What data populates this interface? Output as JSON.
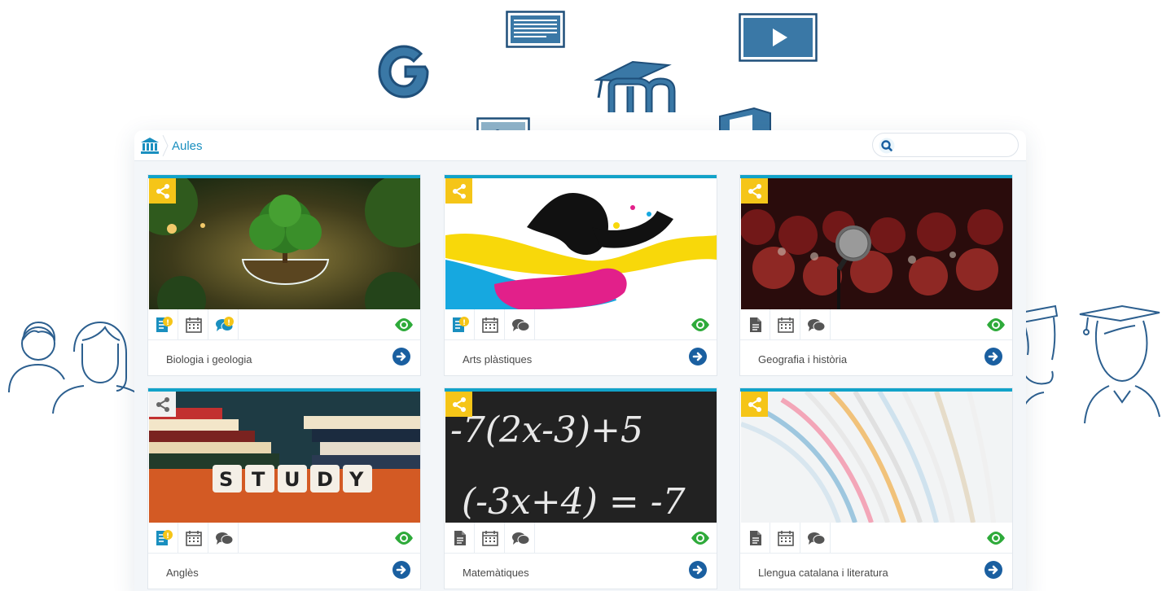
{
  "header": {
    "breadcrumb": "Aules",
    "search_placeholder": ""
  },
  "colors": {
    "accent": "#12a3c9",
    "share_yellow": "#f5c518",
    "icon_blue": "#3a78a6",
    "eye_green": "#2eaa3a",
    "link_blue": "#1a5fa0"
  },
  "floating_icons": [
    "google-icon",
    "document-icon",
    "video-play-icon",
    "moodle-icon",
    "image-icon",
    "office-icon"
  ],
  "courses": [
    {
      "title": "Biologia i geologia",
      "shared": true,
      "notes_badge": true,
      "chat_badge": true
    },
    {
      "title": "Arts plàstiques",
      "shared": true,
      "notes_badge": true,
      "chat_badge": false
    },
    {
      "title": "Geografia i història",
      "shared": true,
      "notes_badge": false,
      "chat_badge": false
    },
    {
      "title": "Anglès",
      "shared": false,
      "notes_badge": true,
      "chat_badge": false
    },
    {
      "title": "Matemàtiques",
      "shared": true,
      "notes_badge": false,
      "chat_badge": false
    },
    {
      "title": "Llengua catalana i literatura",
      "shared": true,
      "notes_badge": false,
      "chat_badge": false
    }
  ]
}
